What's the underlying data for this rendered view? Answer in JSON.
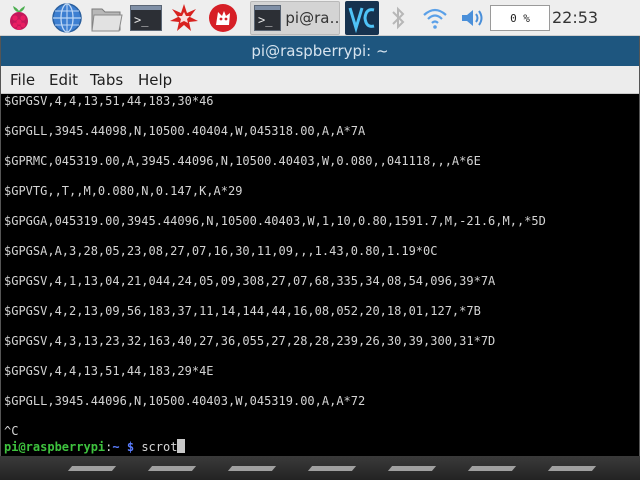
{
  "taskbar": {
    "task_terminal_small_label": "pi@ra…",
    "cpu_text": "0 %",
    "clock": "22:53",
    "icons": [
      "raspberry-menu-icon",
      "web-browser-icon",
      "file-manager-icon",
      "terminal-icon",
      "wolfram-icon",
      "mathematica-icon",
      "vnc-icon",
      "bluetooth-icon",
      "wifi-icon",
      "volume-icon"
    ]
  },
  "window": {
    "title": "pi@raspberrypi: ~",
    "menu": [
      "File",
      "Edit",
      "Tabs",
      "Help"
    ]
  },
  "terminal": {
    "lines": [
      "$GPGSV,4,4,13,51,44,183,30*46",
      "$GPGLL,3945.44098,N,10500.40404,W,045318.00,A,A*7A",
      "$GPRMC,045319.00,A,3945.44096,N,10500.40403,W,0.080,,041118,,,A*6E",
      "$GPVTG,,T,,M,0.080,N,0.147,K,A*29",
      "$GPGGA,045319.00,3945.44096,N,10500.40403,W,1,10,0.80,1591.7,M,-21.6,M,,*5D",
      "$GPGSA,A,3,28,05,23,08,27,07,16,30,11,09,,,1.43,0.80,1.19*0C",
      "$GPGSV,4,1,13,04,21,044,24,05,09,308,27,07,68,335,34,08,54,096,39*7A",
      "$GPGSV,4,2,13,09,56,183,37,11,14,144,44,16,08,052,20,18,01,127,*7B",
      "$GPGSV,4,3,13,23,32,163,40,27,36,055,27,28,28,239,26,30,39,300,31*7D",
      "$GPGSV,4,4,13,51,44,183,29*4E",
      "$GPGLL,3945.44096,N,10500.40403,W,045319.00,A,A*72"
    ],
    "interrupt": "^C",
    "prompt_user": "pi@raspberrypi",
    "prompt_sep": ":",
    "prompt_path": "~",
    "prompt_symbol": " $ ",
    "command": "scrot"
  },
  "colors": {
    "titlebar": "#1e567f",
    "prompt_user": "#3ec23e",
    "prompt_path": "#5a7dff"
  }
}
